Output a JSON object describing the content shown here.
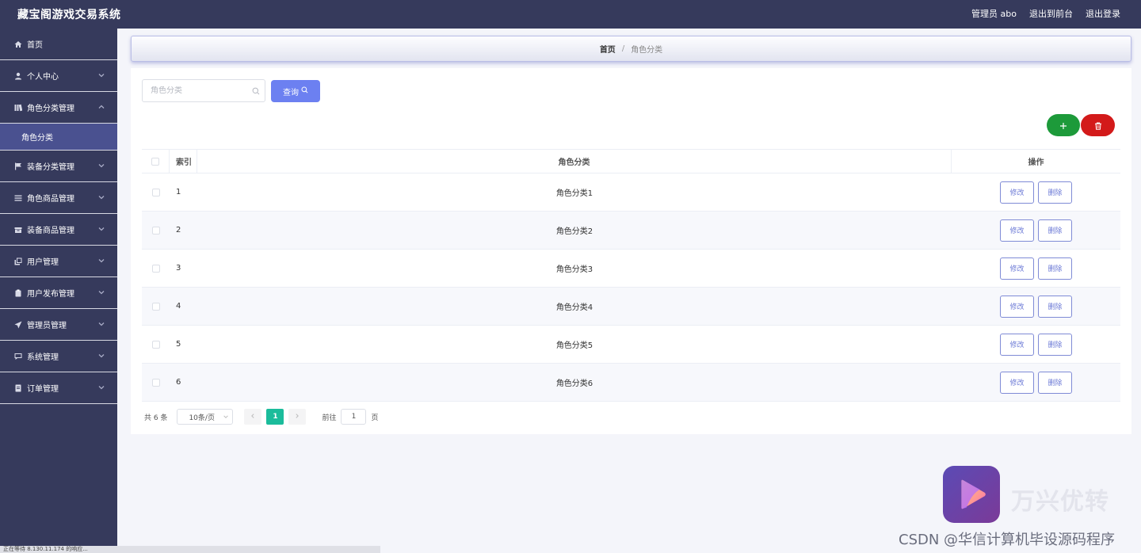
{
  "topbar": {
    "title": "藏宝阁游戏交易系统",
    "user_label": "管理员 abo",
    "to_front_label": "退出到前台",
    "logout_label": "退出登录"
  },
  "sidebar": {
    "items": [
      {
        "label": "首页",
        "icon": "home-icon"
      },
      {
        "label": "个人中心",
        "icon": "user-icon"
      },
      {
        "label": "角色分类管理",
        "icon": "bars-icon"
      },
      {
        "label": "装备分类管理",
        "icon": "flag-icon"
      },
      {
        "label": "角色商品管理",
        "icon": "list-icon"
      },
      {
        "label": "装备商品管理",
        "icon": "box-icon"
      },
      {
        "label": "用户管理",
        "icon": "copy-icon"
      },
      {
        "label": "用户发布管理",
        "icon": "clipboard-icon"
      },
      {
        "label": "管理员管理",
        "icon": "send-icon"
      },
      {
        "label": "系统管理",
        "icon": "chat-icon"
      },
      {
        "label": "订单管理",
        "icon": "doc-icon"
      }
    ],
    "active_sub": "角色分类"
  },
  "breadcrumb": {
    "home": "首页",
    "separator": "/",
    "current": "角色分类"
  },
  "search": {
    "placeholder": "角色分类",
    "button_label": "查询"
  },
  "table": {
    "headers": {
      "index": "索引",
      "name": "角色分类",
      "ops": "操作"
    },
    "rows": [
      {
        "index": "1",
        "name": "角色分类1"
      },
      {
        "index": "2",
        "name": "角色分类2"
      },
      {
        "index": "3",
        "name": "角色分类3"
      },
      {
        "index": "4",
        "name": "角色分类4"
      },
      {
        "index": "5",
        "name": "角色分类5"
      },
      {
        "index": "6",
        "name": "角色分类6"
      }
    ],
    "edit_label": "修改",
    "delete_label": "删除"
  },
  "pagination": {
    "total": "共 6 条",
    "page_size": "10条/页",
    "current_page": "1",
    "goto_prefix": "前往",
    "goto_value": "1",
    "goto_suffix": "页"
  },
  "watermark": {
    "brand": "万兴优转",
    "csdn": "CSDN @华信计算机毕设源码程序"
  },
  "statusbar": {
    "text": "正在等待 8.130.11.174 的响应..."
  },
  "colors": {
    "topbar": "#363a5c",
    "sidebar_active": "#4a5190",
    "query_button": "#6c80f1",
    "add_button": "#1d9a3a",
    "delete_button": "#d31a1a",
    "page_active": "#1bbc9b"
  }
}
